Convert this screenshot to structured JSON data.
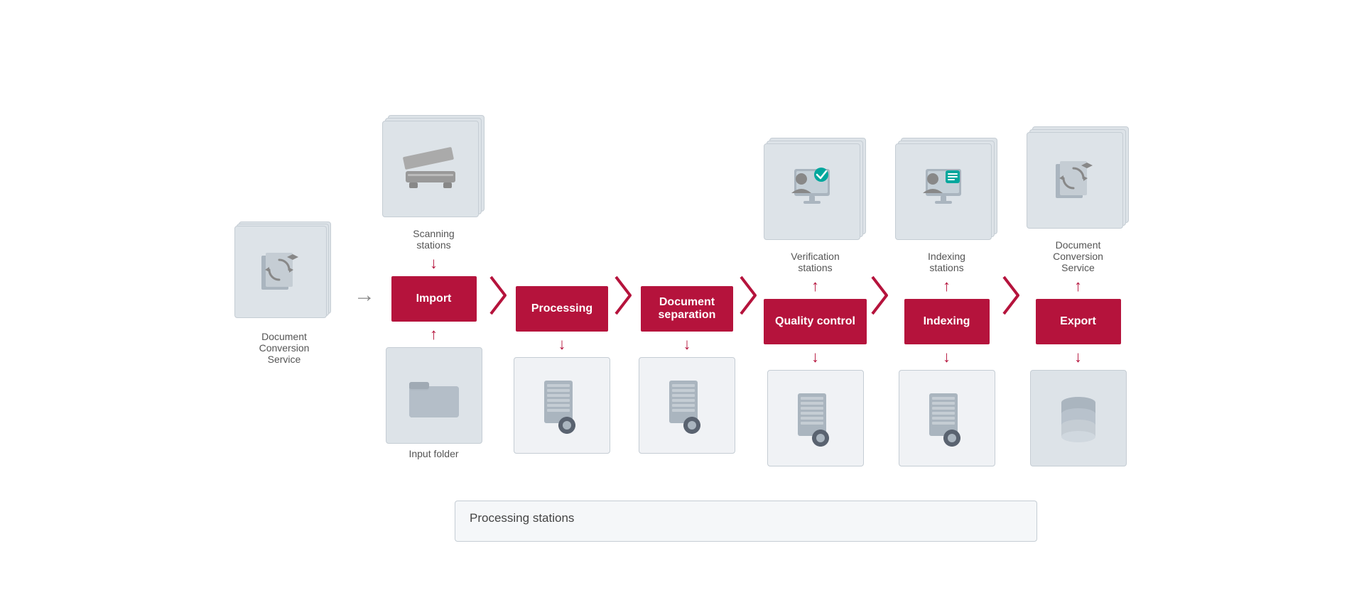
{
  "nodes": {
    "source": {
      "label": "Document\nConversion\nService"
    },
    "scanning": {
      "label": "Scanning\nstations"
    },
    "input_folder": {
      "label": "Input folder"
    },
    "import_box": "Import",
    "processing_box": "Processing",
    "doc_sep_box": "Document\nseparation",
    "quality_box": "Quality control",
    "indexing_box": "Indexing",
    "export_box": "Export",
    "verification": {
      "label": "Verification\nstations"
    },
    "indexing_stations": {
      "label": "Indexing\nstations"
    },
    "doc_conv_service_top": {
      "label": "Document\nConversion\nService"
    },
    "processing_stations_label": "Processing stations",
    "database_label": ""
  },
  "colors": {
    "red": "#b5133c",
    "card_bg": "#dde3e8",
    "card_border": "#c5cdd4",
    "arrow_gray": "#888",
    "text_dark": "#444",
    "white": "#ffffff",
    "teal": "#00a79d"
  }
}
